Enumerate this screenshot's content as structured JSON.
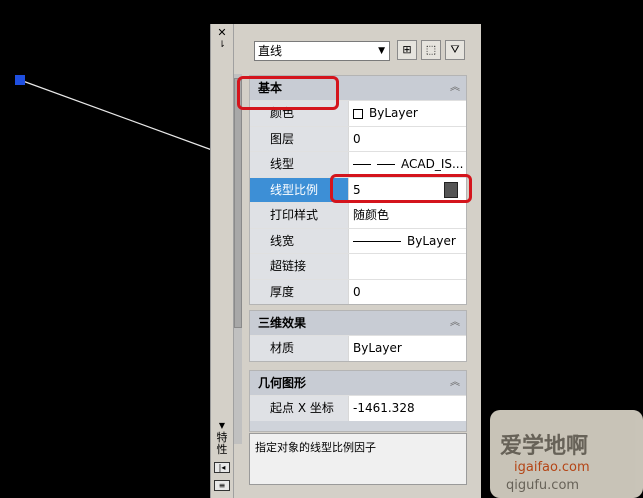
{
  "object_selector": {
    "value": "直线"
  },
  "titlebar": {
    "vertical_label": "特性"
  },
  "sections": [
    {
      "title": "基本",
      "rows": [
        {
          "label": "颜色",
          "value": "ByLayer"
        },
        {
          "label": "图层",
          "value": "0"
        },
        {
          "label": "线型",
          "value": "ACAD_IS..."
        },
        {
          "label": "线型比例",
          "value": "5",
          "selected": true
        },
        {
          "label": "打印样式",
          "value": "随颜色"
        },
        {
          "label": "线宽",
          "value": "ByLayer"
        },
        {
          "label": "超链接",
          "value": ""
        },
        {
          "label": "厚度",
          "value": "0"
        }
      ]
    },
    {
      "title": "三维效果",
      "rows": [
        {
          "label": "材质",
          "value": "ByLayer"
        }
      ]
    },
    {
      "title": "几何图形",
      "rows": [
        {
          "label": "起点 X 坐标",
          "value": "-1461.328"
        }
      ]
    }
  ],
  "description": "指定对象的线型比例因子",
  "watermark": {
    "brand": "爱学地啊",
    "domain": "igaifao.com",
    "sub": "qigufu.com"
  },
  "colors": {
    "highlight": "#3d8fd6",
    "annotation": "#d4141c",
    "canvas": "#000000"
  }
}
